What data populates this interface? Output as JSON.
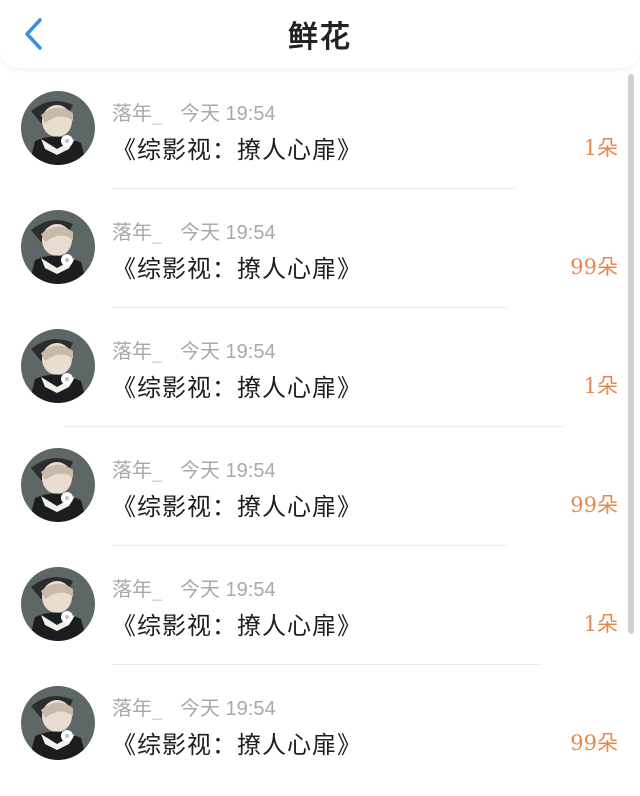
{
  "header": {
    "title": "鲜花",
    "back_icon": "chevron-left-icon",
    "accent_color": "#3a8ee6"
  },
  "rows": [
    {
      "username": "落年_",
      "time": "今天 19:54",
      "book": "《综影视：撩人心扉》",
      "amount": "1朵"
    },
    {
      "username": "落年_",
      "time": "今天 19:54",
      "book": "《综影视：撩人心扉》",
      "amount": "99朵"
    },
    {
      "username": "落年_",
      "time": "今天 19:54",
      "book": "《综影视：撩人心扉》",
      "amount": "1朵"
    },
    {
      "username": "落年_",
      "time": "今天 19:54",
      "book": "《综影视：撩人心扉》",
      "amount": "99朵"
    },
    {
      "username": "落年_",
      "time": "今天 19:54",
      "book": "《综影视：撩人心扉》",
      "amount": "1朵"
    },
    {
      "username": "落年_",
      "time": "今天 19:54",
      "book": "《综影视：撩人心扉》",
      "amount": "99朵"
    }
  ],
  "colors": {
    "amount": "#e8884a",
    "meta_text": "#a9a9a9",
    "body_text": "#1e1e1e"
  }
}
